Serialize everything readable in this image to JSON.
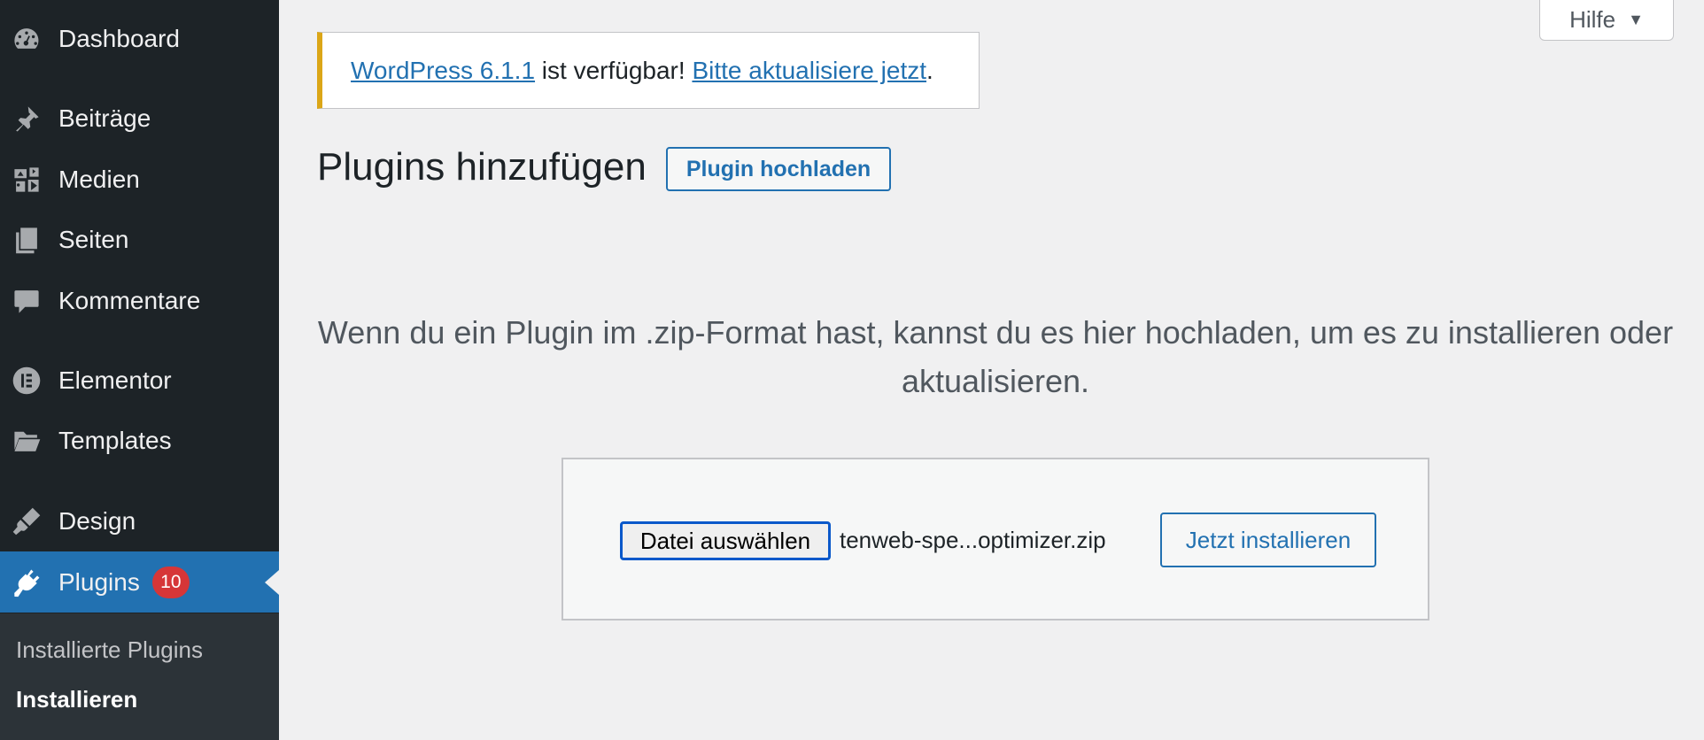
{
  "sidebar": {
    "items": [
      {
        "label": "Dashboard",
        "icon": "dashboard-icon"
      },
      {
        "label": "Beiträge",
        "icon": "pin-icon"
      },
      {
        "label": "Medien",
        "icon": "media-icon"
      },
      {
        "label": "Seiten",
        "icon": "pages-icon"
      },
      {
        "label": "Kommentare",
        "icon": "comment-icon"
      },
      {
        "label": "Elementor",
        "icon": "elementor-icon"
      },
      {
        "label": "Templates",
        "icon": "folder-icon"
      },
      {
        "label": "Design",
        "icon": "brush-icon"
      },
      {
        "label": "Plugins",
        "icon": "plugin-icon",
        "badge": "10",
        "active": true
      }
    ],
    "submenu": [
      {
        "label": "Installierte Plugins"
      },
      {
        "label": "Installieren",
        "current": true
      }
    ]
  },
  "help_tab": {
    "label": "Hilfe",
    "caret": "▼"
  },
  "notice": {
    "version_link": "WordPress 6.1.1",
    "middle_text": " ist verfügbar! ",
    "update_link": "Bitte aktualisiere jetzt",
    "end_text": "."
  },
  "page": {
    "title": "Plugins hinzufügen",
    "upload_toggle": "Plugin hochladen",
    "help_text": "Wenn du ein Plugin im .zip-Format hast, kannst du es hier hochladen, um es zu installieren oder aktualisieren."
  },
  "upload_form": {
    "file_button": "Datei auswählen",
    "file_name": "tenweb-spe...optimizer.zip",
    "install_button": "Jetzt installieren"
  },
  "colors": {
    "sidebar_bg": "#1d2327",
    "accent": "#2271b1",
    "notice_warning": "#dba617",
    "badge": "#d63638"
  }
}
